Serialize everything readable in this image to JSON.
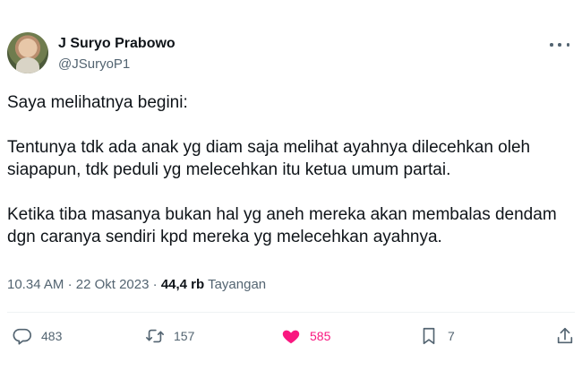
{
  "author": {
    "name": "J Suryo Prabowo",
    "handle": "@JSuryoP1"
  },
  "tweet": {
    "paragraphs": [
      "Saya melihatnya begini:",
      "Tentunya tdk ada anak yg diam saja melihat ayahnya dilecehkan oleh siapapun, tdk peduli yg melecehkan itu ketua umum partai.",
      "Ketika tiba masanya bukan hal yg aneh mereka akan membalas dendam dgn caranya sendiri kpd mereka yg melecehkan ayahnya."
    ],
    "time": "10.34 AM",
    "separator": "·",
    "date": "22 Okt 2023",
    "views_count": "44,4 rb",
    "views_label": "Tayangan"
  },
  "actions": {
    "replies": "483",
    "reposts": "157",
    "likes": "585",
    "bookmarks": "7"
  },
  "colors": {
    "like": "#f91880",
    "muted": "#536471",
    "text": "#0f1419"
  },
  "icons": [
    "more-icon",
    "reply-icon",
    "repost-icon",
    "like-icon",
    "bookmark-icon",
    "share-icon"
  ]
}
